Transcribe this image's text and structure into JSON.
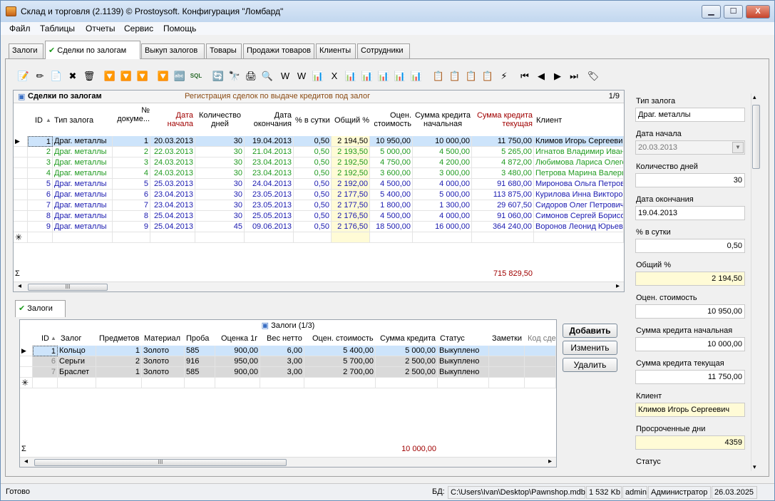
{
  "window": {
    "title": "Склад и торговля (2.1139) © Prostoysoft. Конфигурация \"Ломбард\"",
    "min": "▁",
    "max": "☐",
    "close": "X"
  },
  "menu": [
    "Файл",
    "Таблицы",
    "Отчеты",
    "Сервис",
    "Помощь"
  ],
  "tabs": [
    "Залоги",
    "Сделки по залогам",
    "Выкуп залогов",
    "Товары",
    "Продажи товаров",
    "Клиенты",
    "Сотрудники"
  ],
  "active_tab_index": 1,
  "deals": {
    "title": "Сделки по залогам",
    "subtitle": "Регистрация сделок по выдаче кредитов под залог",
    "page": "1/9",
    "columns": [
      "ID",
      "Тип залога",
      "№ докуме...",
      "Дата начала",
      "Количество дней",
      "Дата окончания",
      "% в сутки",
      "Общий %",
      "Оцен. стоимость",
      "Сумма кредита начальная",
      "Сумма кредита текущая",
      "Клиент"
    ],
    "rows": [
      [
        "1",
        "Драг. металлы",
        "1",
        "20.03.2013",
        "30",
        "19.04.2013",
        "0,50",
        "2 194,50",
        "10 950,00",
        "10 000,00",
        "11 750,00",
        "Климов Игорь Сергеевич"
      ],
      [
        "2",
        "Драг. металлы",
        "2",
        "22.03.2013",
        "30",
        "21.04.2013",
        "0,50",
        "2 193,50",
        "5 000,00",
        "4 500,00",
        "5 265,00",
        "Игнатов Владимир Иван"
      ],
      [
        "3",
        "Драг. металлы",
        "3",
        "24.03.2013",
        "30",
        "23.04.2013",
        "0,50",
        "2 192,50",
        "4 750,00",
        "4 200,00",
        "4 872,00",
        "Любимова Лариса Олего"
      ],
      [
        "4",
        "Драг. металлы",
        "4",
        "24.03.2013",
        "30",
        "23.04.2013",
        "0,50",
        "2 192,50",
        "3 600,00",
        "3 000,00",
        "3 480,00",
        "Петрова Марина Валерь"
      ],
      [
        "5",
        "Драг. металлы",
        "5",
        "25.03.2013",
        "30",
        "24.04.2013",
        "0,50",
        "2 192,00",
        "4 500,00",
        "4 000,00",
        "91 680,00",
        "Миронова Ольга Петров"
      ],
      [
        "6",
        "Драг. металлы",
        "6",
        "23.04.2013",
        "30",
        "23.05.2013",
        "0,50",
        "2 177,50",
        "5 400,00",
        "5 000,00",
        "113 875,00",
        "Курилова Инна Викторов"
      ],
      [
        "7",
        "Драг. металлы",
        "7",
        "23.04.2013",
        "30",
        "23.05.2013",
        "0,50",
        "2 177,50",
        "1 800,00",
        "1 300,00",
        "29 607,50",
        "Сидоров Олег Петрович"
      ],
      [
        "8",
        "Драг. металлы",
        "8",
        "25.04.2013",
        "30",
        "25.05.2013",
        "0,50",
        "2 176,50",
        "4 500,00",
        "4 000,00",
        "91 060,00",
        "Симонов Сергей Борисо"
      ],
      [
        "9",
        "Драг. металлы",
        "9",
        "25.04.2013",
        "45",
        "09.06.2013",
        "0,50",
        "2 176,50",
        "18 500,00",
        "16 000,00",
        "364 240,00",
        "Воронов Леонид Юрьеви"
      ]
    ],
    "row_colors": [
      "#000000",
      "#1f9a1f",
      "#1f9a1f",
      "#1f9a1f",
      "#1a1ab0",
      "#1a1ab0",
      "#1a1ab0",
      "#1a1ab0",
      "#1a1ab0"
    ],
    "total": "715 829,50",
    "sigma": "Σ"
  },
  "pledges": {
    "tab": "Залоги",
    "title": "Залоги (1/3)",
    "columns": [
      "ID",
      "Залог",
      "Предметов",
      "Материал",
      "Проба",
      "Оценка 1г",
      "Вес нетто",
      "Оцен. стоимость",
      "Сумма кредита",
      "Статус",
      "Заметки",
      "Код сде"
    ],
    "rows": [
      [
        "1",
        "Кольцо",
        "1",
        "Золото",
        "585",
        "900,00",
        "6,00",
        "5 400,00",
        "5 000,00",
        "Выкуплено",
        ""
      ],
      [
        "6",
        "Серьги",
        "2",
        "Золото",
        "916",
        "950,00",
        "3,00",
        "5 700,00",
        "2 500,00",
        "Выкуплено",
        ""
      ],
      [
        "7",
        "Браслет",
        "1",
        "Золото",
        "585",
        "900,00",
        "3,00",
        "2 700,00",
        "2 500,00",
        "Выкуплено",
        ""
      ]
    ],
    "total": "10 000,00",
    "sigma": "Σ",
    "buttons": {
      "add": "Добавить",
      "edit": "Изменить",
      "delete": "Удалить"
    }
  },
  "form": [
    {
      "label": "Тип залога",
      "value": "Драг. металлы",
      "align": "left",
      "style": "plain"
    },
    {
      "label": "Дата начала",
      "value": "20.03.2013",
      "align": "left",
      "style": "combo"
    },
    {
      "label": "Количество дней",
      "value": "30",
      "align": "right",
      "style": "plain"
    },
    {
      "label": "Дата окончания",
      "value": "19.04.2013",
      "align": "left",
      "style": "plain"
    },
    {
      "label": "% в сутки",
      "value": "0,50",
      "align": "right",
      "style": "plain"
    },
    {
      "label": "Общий %",
      "value": "2 194,50",
      "align": "right",
      "style": "yellow"
    },
    {
      "label": "Оцен. стоимость",
      "value": "10 950,00",
      "align": "right",
      "style": "plain"
    },
    {
      "label": "Сумма кредита начальная",
      "value": "10 000,00",
      "align": "right",
      "style": "plain"
    },
    {
      "label": "Сумма кредита текущая",
      "value": "11 750,00",
      "align": "right",
      "style": "plain"
    },
    {
      "label": "Клиент",
      "value": "Климов Игорь Сергеевич",
      "align": "left",
      "style": "yellow"
    },
    {
      "label": "Просроченные дни",
      "value": "4359",
      "align": "right",
      "style": "yellow"
    },
    {
      "label": "Статус",
      "value": "",
      "align": "left",
      "style": "plain"
    }
  ],
  "status": {
    "ready": "Готово",
    "db_label": "БД:",
    "db_path": "C:\\Users\\Ivan\\Desktop\\Pawnshop.mdb",
    "size": "1 532 Kb",
    "user": "admin",
    "role": "Администратор",
    "date": "26.03.2025"
  },
  "toolbar_icons": [
    "📝",
    "✏",
    "📄",
    "✖",
    "🗑",
    "🔽",
    "🔽",
    "🔽",
    "🔽",
    "🔤",
    "SQL",
    "🔄",
    "🔭",
    "🖨",
    "🔍",
    "W",
    "W",
    "📊",
    "X",
    "📊",
    "📊",
    "📊",
    "📊",
    "📊",
    "📋",
    "📋",
    "📋",
    "📋",
    "⚡",
    "⏮",
    "◀",
    "▶",
    "⏭",
    "🏷"
  ]
}
